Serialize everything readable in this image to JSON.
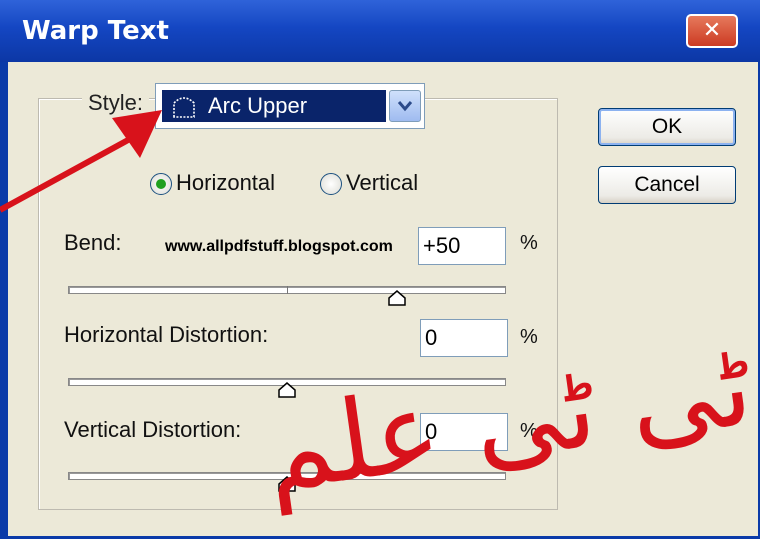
{
  "window": {
    "title": "Warp Text",
    "close_label": "✕"
  },
  "style": {
    "label": "Style:",
    "value": "Arc Upper",
    "icon": "arc-upper-icon"
  },
  "buttons": {
    "ok": "OK",
    "cancel": "Cancel"
  },
  "orientation": {
    "options": [
      "Horizontal",
      "Vertical"
    ],
    "selected": "Horizontal"
  },
  "bend": {
    "label": "Bend:",
    "value": "+50",
    "unit": "%",
    "slider_value": 50
  },
  "horizontal_distortion": {
    "label": "Horizontal Distortion:",
    "value": "0",
    "unit": "%",
    "slider_value": 0
  },
  "vertical_distortion": {
    "label": "Vertical Distortion:",
    "value": "0",
    "unit": "%",
    "slider_value": 0
  },
  "watermark": "www.allpdfstuff.blogspot.com",
  "annotation": {
    "urdu_text": "ٹی ٹی علم",
    "arrow_color": "#d8121b"
  }
}
